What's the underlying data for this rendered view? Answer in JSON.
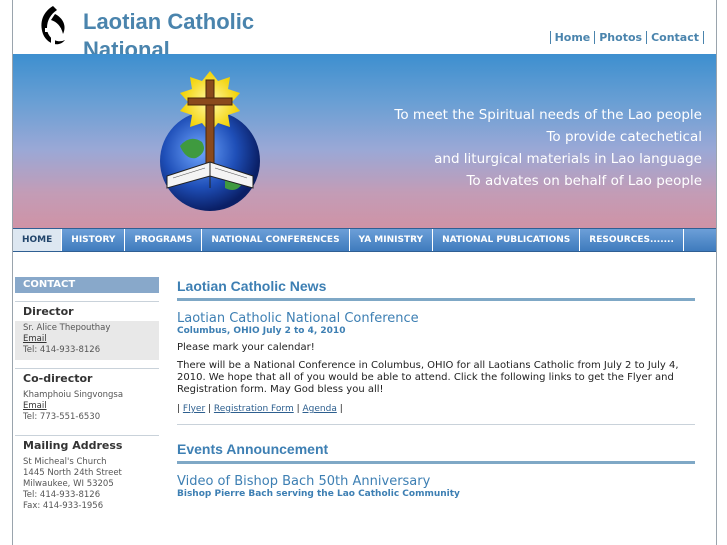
{
  "header": {
    "site_title": "Laotian Catholic National",
    "top_nav": [
      "Home",
      "Photos",
      "Contact"
    ]
  },
  "banner": {
    "mission_lines": [
      "To meet the Spiritual needs of the Lao people",
      "To provide catechetical",
      "and liturgical materials in Lao language",
      "To advates on behalf of Lao people"
    ]
  },
  "main_nav": [
    "HOME",
    "HISTORY",
    "PROGRAMS",
    "NATIONAL CONFERENCES",
    "YA MINISTRY",
    "NATIONAL PUBLICATIONS",
    "RESOURCES......."
  ],
  "sidebar": {
    "head": "CONTACT",
    "director": {
      "title": "Director",
      "name": "Sr. Alice Thepouthay",
      "email": "Email",
      "tel": "Tel: 414-933-8126"
    },
    "codirector": {
      "title": "Co-director",
      "name": "Khamphoiu Singvongsa",
      "email": "Email",
      "tel": "Tel: 773-551-6530"
    },
    "mailing": {
      "title": "Mailing Address",
      "lines": [
        "St Micheal's Church",
        "1445 North 24th Street",
        "Milwaukee, WI 53205",
        "Tel: 414-933-8126",
        "Fax: 414-933-1956"
      ]
    }
  },
  "content": {
    "news_heading": "Laotian Catholic News",
    "news_title": "Laotian Catholic National Conference",
    "news_sub": "Columbus, OHIO July 2 to 4, 2010",
    "para1": "Please mark your calendar!",
    "para2": "There will be a National Conference in Columbus, OHIO for all Laotians Catholic from July 2 to July 4, 2010. We hope that all of you would be able to attend. Click the following links to get the Flyer and Registration form. May God bless you all!",
    "links": [
      "Flyer",
      "Registration Form",
      "Agenda"
    ],
    "events_heading": "Events Announcement",
    "video_title": "Video of Bishop Bach 50th Anniversary",
    "video_sub": "Bishop Pierre Bach serving the Lao Catholic Community"
  },
  "colors": {
    "brand_blue": "#4a84ad",
    "nav_blue": "#3f7bbd"
  }
}
